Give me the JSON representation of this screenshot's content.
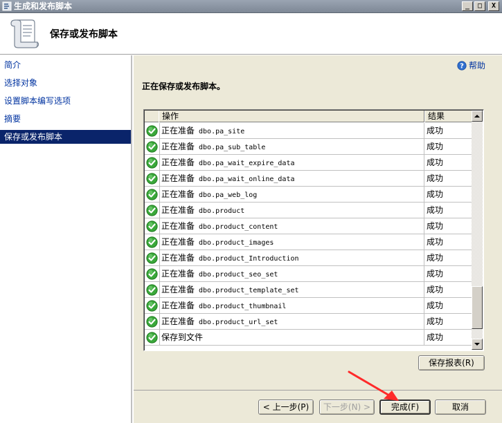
{
  "window": {
    "title": "生成和发布脚本",
    "minimize": "_",
    "maximize": "□",
    "close": "X"
  },
  "header": {
    "title": "保存或发布脚本"
  },
  "nav": {
    "items": [
      {
        "label": "简介",
        "selected": false
      },
      {
        "label": "选择对象",
        "selected": false
      },
      {
        "label": "设置脚本编写选项",
        "selected": false
      },
      {
        "label": "摘要",
        "selected": false
      },
      {
        "label": "保存或发布脚本",
        "selected": true
      }
    ]
  },
  "help": {
    "label": "帮助"
  },
  "main": {
    "heading": "正在保存或发布脚本。"
  },
  "grid": {
    "columns": [
      "操作",
      "结果"
    ],
    "rows": [
      {
        "prefix": "正在准备",
        "object": "dbo.pa_site",
        "result": "成功"
      },
      {
        "prefix": "正在准备",
        "object": "dbo.pa_sub_table",
        "result": "成功"
      },
      {
        "prefix": "正在准备",
        "object": "dbo.pa_wait_expire_data",
        "result": "成功"
      },
      {
        "prefix": "正在准备",
        "object": "dbo.pa_wait_online_data",
        "result": "成功"
      },
      {
        "prefix": "正在准备",
        "object": "dbo.pa_web_log",
        "result": "成功"
      },
      {
        "prefix": "正在准备",
        "object": "dbo.product",
        "result": "成功"
      },
      {
        "prefix": "正在准备",
        "object": "dbo.product_content",
        "result": "成功"
      },
      {
        "prefix": "正在准备",
        "object": "dbo.product_images",
        "result": "成功"
      },
      {
        "prefix": "正在准备",
        "object": "dbo.product_Introduction",
        "result": "成功"
      },
      {
        "prefix": "正在准备",
        "object": "dbo.product_seo_set",
        "result": "成功"
      },
      {
        "prefix": "正在准备",
        "object": "dbo.product_template_set",
        "result": "成功"
      },
      {
        "prefix": "正在准备",
        "object": "dbo.product_thumbnail",
        "result": "成功"
      },
      {
        "prefix": "正在准备",
        "object": "dbo.product_url_set",
        "result": "成功"
      },
      {
        "prefix": "保存到文件",
        "object": "",
        "result": "成功"
      }
    ]
  },
  "buttons": {
    "save_report": "保存报表(R)",
    "prev": "< 上一步(P)",
    "next": "下一步(N) >",
    "finish": "完成(F)",
    "cancel": "取消"
  },
  "colors": {
    "title_bar": "#8a94a2",
    "selection": "#0a246a",
    "link": "#0033a0",
    "success": "#3aa83a",
    "annotation_arrow": "#ff2a2a"
  }
}
